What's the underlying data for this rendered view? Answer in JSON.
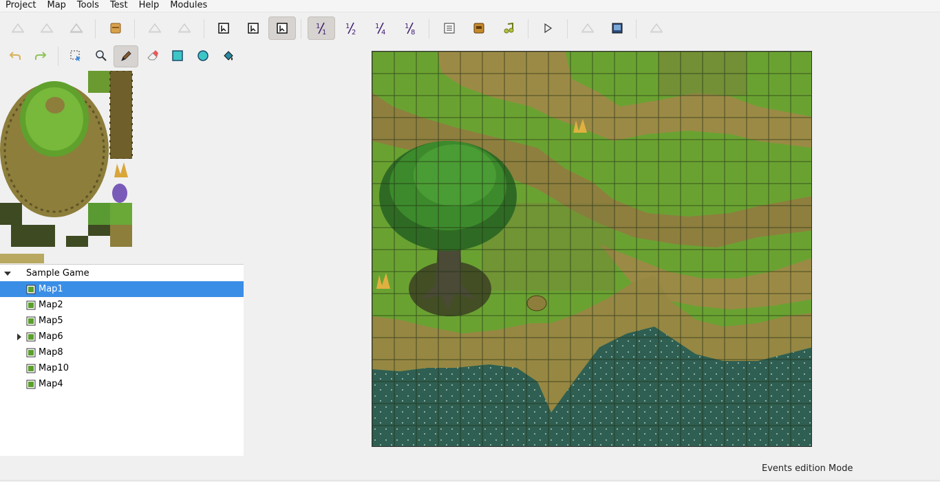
{
  "menubar": {
    "items": [
      "Project",
      "Map",
      "Tools",
      "Test",
      "Help",
      "Modules"
    ]
  },
  "toolbar": {
    "buttons": [
      {
        "name": "disabled-save-icon"
      },
      {
        "name": "disabled-close-icon"
      },
      {
        "name": "disabled-upload-icon"
      },
      {
        "name": "database-icon"
      },
      {
        "name": "disabled-undo-icon"
      },
      {
        "name": "disabled-redo-icon"
      },
      {
        "name": "layer-1-icon"
      },
      {
        "name": "layer-2-icon"
      },
      {
        "name": "layer-3-icon",
        "pressed": true
      },
      {
        "name": "zoom-1-1-icon",
        "label": "1/1",
        "pressed": true
      },
      {
        "name": "zoom-1-2-icon",
        "label": "1/2"
      },
      {
        "name": "zoom-1-4-icon",
        "label": "1/4"
      },
      {
        "name": "zoom-1-8-icon",
        "label": "1/8"
      },
      {
        "name": "script-editor-icon"
      },
      {
        "name": "resource-manager-icon"
      },
      {
        "name": "sound-test-icon"
      },
      {
        "name": "play-test-icon"
      },
      {
        "name": "disabled-fullscreen-icon"
      },
      {
        "name": "screen-icon"
      },
      {
        "name": "disabled-help-icon"
      }
    ]
  },
  "toolbar2": {
    "tools": [
      "undo-icon",
      "redo-icon",
      "selection-icon",
      "zoom-icon",
      "pencil-icon",
      "eraser-icon",
      "rectangle-icon",
      "circle-icon",
      "fill-icon"
    ]
  },
  "tree": {
    "root": "Sample Game",
    "maps": [
      {
        "label": "Map1",
        "selected": true,
        "expandable": false
      },
      {
        "label": "Map2",
        "selected": false,
        "expandable": false
      },
      {
        "label": "Map5",
        "selected": false,
        "expandable": false
      },
      {
        "label": "Map6",
        "selected": false,
        "expandable": true
      },
      {
        "label": "Map8",
        "selected": false,
        "expandable": false
      },
      {
        "label": "Map10",
        "selected": false,
        "expandable": false
      },
      {
        "label": "Map4",
        "selected": false,
        "expandable": false
      }
    ]
  },
  "status": {
    "mode": "Events edition Mode"
  },
  "colors": {
    "grass": "#6fa33a",
    "cliff": "#9a8b45",
    "water": "#2f5f52",
    "selection": "#3a8ee6"
  }
}
